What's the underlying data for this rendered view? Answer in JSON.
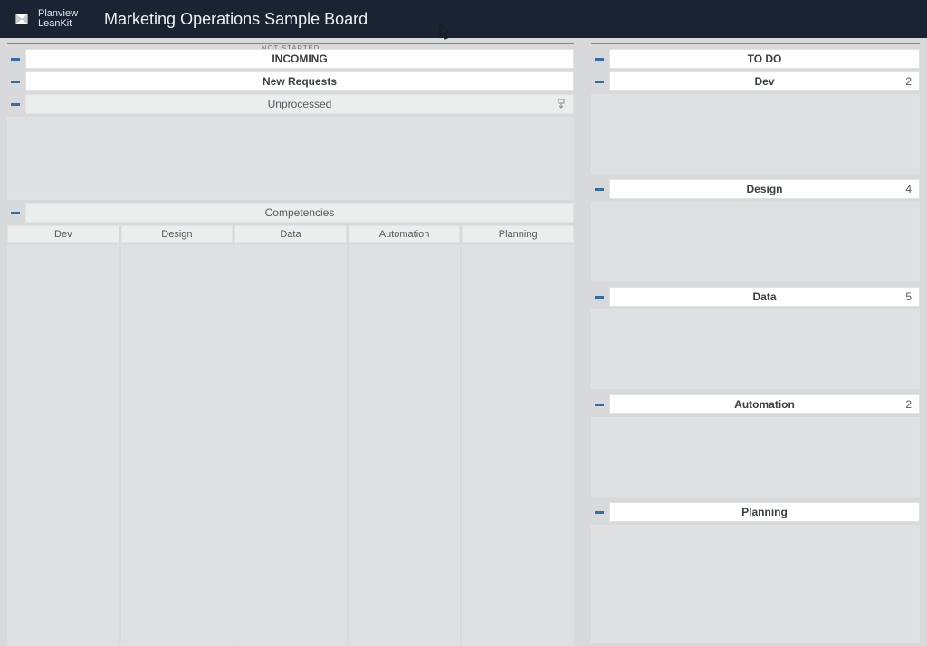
{
  "header": {
    "brand_line1": "Planview",
    "brand_line2": "LeanKit",
    "board_title": "Marketing Operations Sample Board"
  },
  "sections": {
    "left": {
      "phase_label": "NOT STARTED",
      "top_lane": "INCOMING",
      "sublane": "New Requests",
      "subsublane": "Unprocessed",
      "group_lane": "Competencies",
      "columns": [
        "Dev",
        "Design",
        "Data",
        "Automation",
        "Planning"
      ]
    },
    "right": {
      "top_lane": "TO DO",
      "sublanes": [
        {
          "label": "Dev",
          "count": 2
        },
        {
          "label": "Design",
          "count": 4
        },
        {
          "label": "Data",
          "count": 5
        },
        {
          "label": "Automation",
          "count": 2
        },
        {
          "label": "Planning",
          "count": ""
        }
      ]
    }
  }
}
